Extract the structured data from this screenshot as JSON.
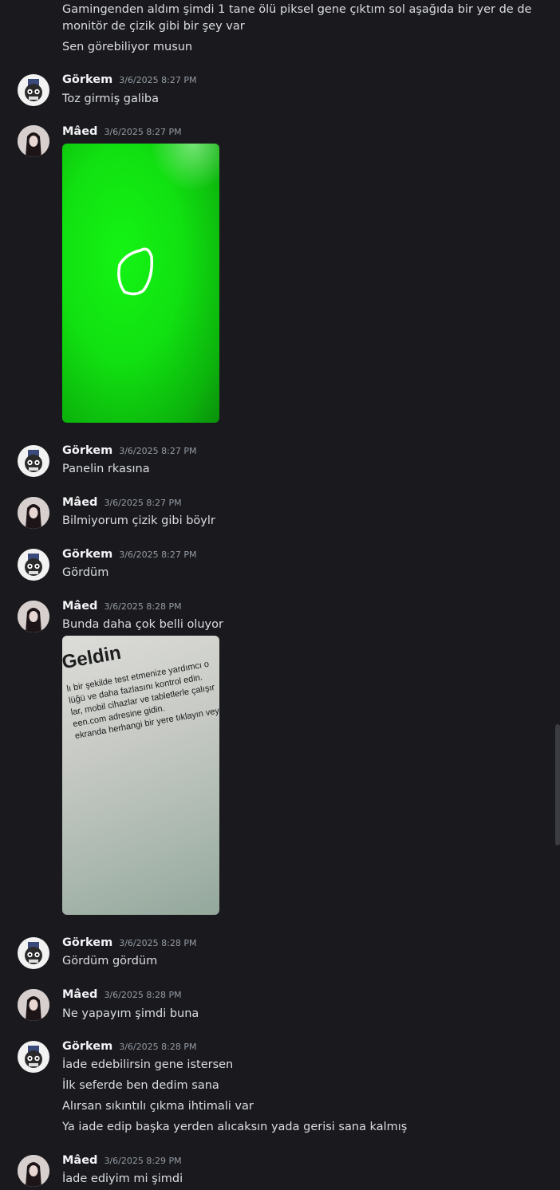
{
  "continuation_lines": [
    "Gamingenden aldım şimdi 1 tane ölü piksel gene çıktım sol aşağıda bir yer de de",
    "monitör de çizik gibi bir şey var",
    "Sen görebiliyor musun"
  ],
  "messages": [
    {
      "author": "Görkem",
      "timestamp": "3/6/2025 8:27 PM",
      "lines": [
        "Toz girmiş galiba"
      ]
    },
    {
      "author": "Mâed",
      "timestamp": "3/6/2025 8:27 PM",
      "lines": []
    },
    {
      "author": "Görkem",
      "timestamp": "3/6/2025 8:27 PM",
      "lines": [
        "Panelin rkasına"
      ]
    },
    {
      "author": "Mâed",
      "timestamp": "3/6/2025 8:27 PM",
      "lines": [
        "Bilmiyorum çizik gibi böylr"
      ]
    },
    {
      "author": "Görkem",
      "timestamp": "3/6/2025 8:27 PM",
      "lines": [
        "Gördüm"
      ]
    },
    {
      "author": "Mâed",
      "timestamp": "3/6/2025 8:28 PM",
      "lines": [
        "Bunda daha çok belli oluyor"
      ]
    },
    {
      "author": "Görkem",
      "timestamp": "3/6/2025 8:28 PM",
      "lines": [
        "Gördüm gördüm"
      ]
    },
    {
      "author": "Mâed",
      "timestamp": "3/6/2025 8:28 PM",
      "lines": [
        "Ne yapayım şimdi buna"
      ]
    },
    {
      "author": "Görkem",
      "timestamp": "3/6/2025 8:28 PM",
      "lines": [
        "İade edebilirsin gene istersen",
        "İlk seferde ben dedim sana",
        "Alırsan sıkıntılı çıkma ihtimali var",
        "Ya iade edip başka yerden alıcaksın yada gerisi sana kalmış"
      ]
    },
    {
      "author": "Mâed",
      "timestamp": "3/6/2025 8:29 PM",
      "lines": [
        "İade ediyim mi şimdi"
      ]
    }
  ],
  "attachments": {
    "photo_text": [
      "Geldin",
      "lı bir şekilde test etmenize yardımcı o",
      "lüğü ve daha fazlasını kontrol edin.",
      "lar, mobil cihazlar ve tabletlerle çalışır",
      "een.com adresine gidin.",
      "ekranda herhangi bir yere tıklayın vey"
    ]
  },
  "colors": {
    "background": "#1a1a1e",
    "text": "#dbdee1",
    "author": "#f2f3f5",
    "timestamp": "#949ba4",
    "green_screen": "#12e010"
  }
}
